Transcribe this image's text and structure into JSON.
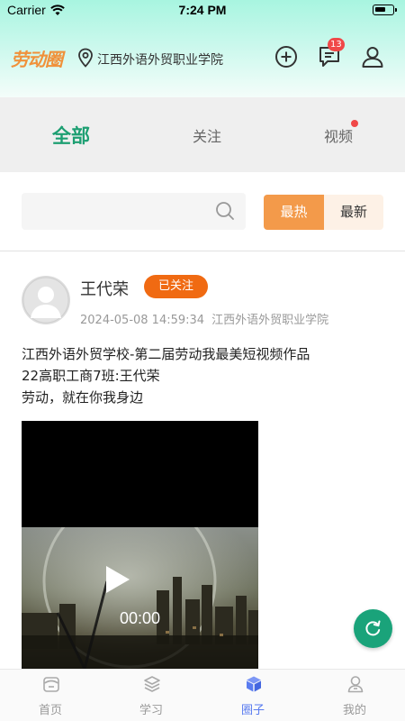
{
  "status_bar": {
    "carrier": "Carrier",
    "time": "7:24 PM"
  },
  "header": {
    "brand": "劳动圈",
    "location": "江西外语外贸职业学院",
    "message_badge": "13",
    "icons": [
      "location-pin-icon",
      "add-circle-icon",
      "message-icon",
      "user-icon"
    ]
  },
  "tabs": [
    {
      "label": "全部",
      "active": true
    },
    {
      "label": "关注",
      "active": false
    },
    {
      "label": "视频",
      "active": false,
      "dot": true
    }
  ],
  "search": {
    "placeholder": ""
  },
  "sort": {
    "hot": "最热",
    "latest": "最新",
    "selected": "最热"
  },
  "post": {
    "author": "王代荣",
    "follow_status": "已关注",
    "datetime": "2024-05-08 14:59:34",
    "school": "江西外语外贸职业学院",
    "content_lines": [
      "江西外语外贸学校-第二届劳动我最美短视频作品",
      "22高职工商7班:王代荣",
      "劳动，就在你我身边"
    ],
    "video_duration": "00:00"
  },
  "bottom_nav": [
    {
      "label": "首页",
      "icon": "home-icon",
      "active": false
    },
    {
      "label": "学习",
      "icon": "layers-icon",
      "active": false
    },
    {
      "label": "圈子",
      "icon": "cube-icon",
      "active": true
    },
    {
      "label": "我的",
      "icon": "profile-icon",
      "active": false
    }
  ],
  "colors": {
    "accent_green": "#1d9f72",
    "accent_orange": "#f39a4a",
    "follow_orange": "#f06a12",
    "badge_red": "#f04848",
    "nav_active_blue": "#5a7cf0"
  }
}
